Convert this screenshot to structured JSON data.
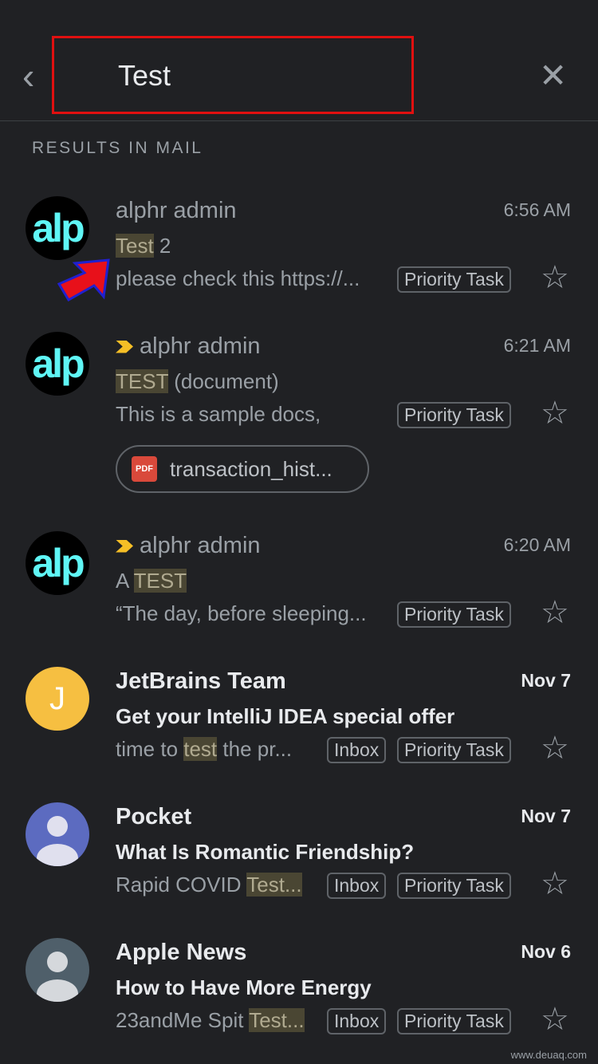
{
  "search": {
    "query": "Test"
  },
  "section_label": "RESULTS IN MAIL",
  "accent": "#e01010",
  "emails": [
    {
      "sender": "alphr admin",
      "time": "6:56 AM",
      "subject_hl": "Test",
      "subject_rest": " 2",
      "snippet": "please check this https://...",
      "labels": [
        "Priority Task"
      ],
      "avatar": "alp",
      "unread": false,
      "important": false
    },
    {
      "sender": "alphr admin",
      "time": "6:21 AM",
      "subject_hl": "TEST",
      "subject_rest": " (document)",
      "snippet": "This is a sample docs,",
      "labels": [
        "Priority Task"
      ],
      "avatar": "alp",
      "unread": false,
      "important": true,
      "attachment": {
        "type": "PDF",
        "name": "transaction_hist..."
      }
    },
    {
      "sender": "alphr admin",
      "time": "6:20 AM",
      "subject_pre": "A ",
      "subject_hl": "TEST",
      "snippet": "“The day, before sleeping...",
      "labels": [
        "Priority Task"
      ],
      "avatar": "alp",
      "unread": false,
      "important": true
    },
    {
      "sender": "JetBrains Team",
      "time": "Nov 7",
      "subject": "Get your IntelliJ IDEA special offer",
      "snippet_pre": "time to ",
      "snippet_hl": "test",
      "snippet_post": " the pr...",
      "labels": [
        "Inbox",
        "Priority Task"
      ],
      "avatar": "J",
      "avatar_color": "#f6bf41",
      "unread": true
    },
    {
      "sender": "Pocket",
      "time": "Nov 7",
      "subject": "What Is Romantic Friendship?",
      "snippet_pre": "Rapid COVID ",
      "snippet_hl": "Test...",
      "labels": [
        "Inbox",
        "Priority Task"
      ],
      "avatar_color": "#5c6bc0",
      "unread": true
    },
    {
      "sender": "Apple News",
      "time": "Nov 6",
      "subject": "How to Have More Energy",
      "snippet_pre": "23andMe Spit ",
      "snippet_hl": "Test...",
      "labels": [
        "Inbox",
        "Priority Task"
      ],
      "avatar_color": "#4f5f6a",
      "unread": true
    }
  ],
  "watermark": "www.deuaq.com"
}
